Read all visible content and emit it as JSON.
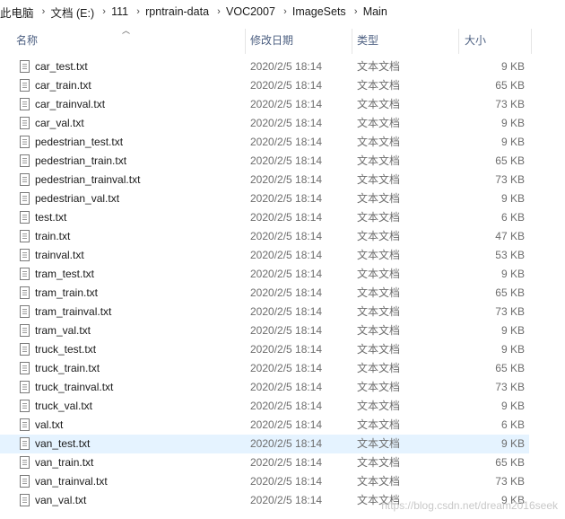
{
  "breadcrumb": [
    "此电脑",
    "文档 (E:)",
    "111",
    "rpntrain-data",
    "VOC2007",
    "ImageSets",
    "Main"
  ],
  "columns": {
    "name": "名称",
    "date": "修改日期",
    "type": "类型",
    "size": "大小"
  },
  "files": [
    {
      "name": "car_test.txt",
      "date": "2020/2/5 18:14",
      "type": "文本文档",
      "size": "9 KB"
    },
    {
      "name": "car_train.txt",
      "date": "2020/2/5 18:14",
      "type": "文本文档",
      "size": "65 KB"
    },
    {
      "name": "car_trainval.txt",
      "date": "2020/2/5 18:14",
      "type": "文本文档",
      "size": "73 KB"
    },
    {
      "name": "car_val.txt",
      "date": "2020/2/5 18:14",
      "type": "文本文档",
      "size": "9 KB"
    },
    {
      "name": "pedestrian_test.txt",
      "date": "2020/2/5 18:14",
      "type": "文本文档",
      "size": "9 KB"
    },
    {
      "name": "pedestrian_train.txt",
      "date": "2020/2/5 18:14",
      "type": "文本文档",
      "size": "65 KB"
    },
    {
      "name": "pedestrian_trainval.txt",
      "date": "2020/2/5 18:14",
      "type": "文本文档",
      "size": "73 KB"
    },
    {
      "name": "pedestrian_val.txt",
      "date": "2020/2/5 18:14",
      "type": "文本文档",
      "size": "9 KB"
    },
    {
      "name": "test.txt",
      "date": "2020/2/5 18:14",
      "type": "文本文档",
      "size": "6 KB"
    },
    {
      "name": "train.txt",
      "date": "2020/2/5 18:14",
      "type": "文本文档",
      "size": "47 KB"
    },
    {
      "name": "trainval.txt",
      "date": "2020/2/5 18:14",
      "type": "文本文档",
      "size": "53 KB"
    },
    {
      "name": "tram_test.txt",
      "date": "2020/2/5 18:14",
      "type": "文本文档",
      "size": "9 KB"
    },
    {
      "name": "tram_train.txt",
      "date": "2020/2/5 18:14",
      "type": "文本文档",
      "size": "65 KB"
    },
    {
      "name": "tram_trainval.txt",
      "date": "2020/2/5 18:14",
      "type": "文本文档",
      "size": "73 KB"
    },
    {
      "name": "tram_val.txt",
      "date": "2020/2/5 18:14",
      "type": "文本文档",
      "size": "9 KB"
    },
    {
      "name": "truck_test.txt",
      "date": "2020/2/5 18:14",
      "type": "文本文档",
      "size": "9 KB"
    },
    {
      "name": "truck_train.txt",
      "date": "2020/2/5 18:14",
      "type": "文本文档",
      "size": "65 KB"
    },
    {
      "name": "truck_trainval.txt",
      "date": "2020/2/5 18:14",
      "type": "文本文档",
      "size": "73 KB"
    },
    {
      "name": "truck_val.txt",
      "date": "2020/2/5 18:14",
      "type": "文本文档",
      "size": "9 KB"
    },
    {
      "name": "val.txt",
      "date": "2020/2/5 18:14",
      "type": "文本文档",
      "size": "6 KB"
    },
    {
      "name": "van_test.txt",
      "date": "2020/2/5 18:14",
      "type": "文本文档",
      "size": "9 KB"
    },
    {
      "name": "van_train.txt",
      "date": "2020/2/5 18:14",
      "type": "文本文档",
      "size": "65 KB"
    },
    {
      "name": "van_trainval.txt",
      "date": "2020/2/5 18:14",
      "type": "文本文档",
      "size": "73 KB"
    },
    {
      "name": "van_val.txt",
      "date": "2020/2/5 18:14",
      "type": "文本文档",
      "size": "9 KB"
    }
  ],
  "hover_row": "van_test.txt",
  "watermark": "https://blog.csdn.net/dream2016seek",
  "icons": {
    "file": "text-file-icon",
    "separator": "chevron-right-icon",
    "sort": "sort-up-icon"
  }
}
